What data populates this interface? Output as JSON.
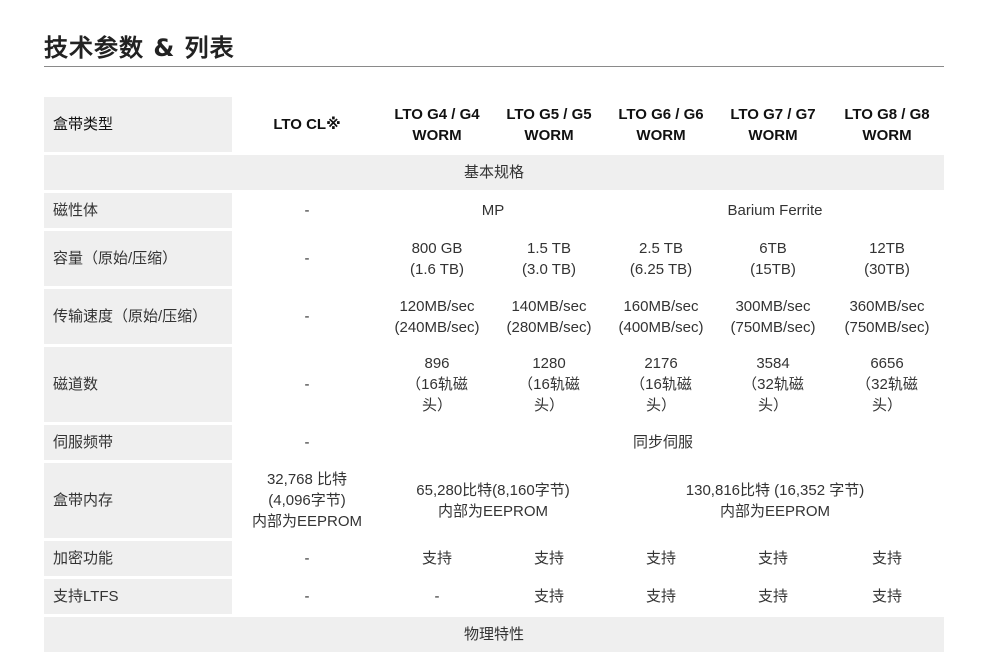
{
  "title": "技术参数 & 列表",
  "header": {
    "label": "盒带类型",
    "cols": [
      "LTO CL※",
      "LTO G4 / G4 WORM",
      "LTO G5 / G5 WORM",
      "LTO G6 / G6 WORM",
      "LTO G7 / G7 WORM",
      "LTO G8 / G8 WORM"
    ]
  },
  "sections": {
    "basic": "基本规格",
    "physical": "物理特性"
  },
  "rows": {
    "magnetic": {
      "label": "磁性体",
      "cl": "-",
      "mp": "MP",
      "baf": "Barium Ferrite"
    },
    "capacity": {
      "label": "容量（原始/压缩）",
      "cells": [
        "-",
        "800 GB\n(1.6 TB)",
        "1.5 TB\n(3.0 TB)",
        "2.5 TB\n(6.25 TB)",
        "6TB\n(15TB)",
        "12TB\n(30TB)"
      ]
    },
    "speed": {
      "label": "传输速度（原始/压缩）",
      "cells": [
        "-",
        "120MB/sec\n(240MB/sec)",
        "140MB/sec\n(280MB/sec)",
        "160MB/sec\n(400MB/sec)",
        "300MB/sec\n(750MB/sec)",
        "360MB/sec\n(750MB/sec)"
      ]
    },
    "tracks": {
      "label": "磁道数",
      "cells": [
        "-",
        "896\n（16轨磁\n头）",
        "1280\n（16轨磁\n头）",
        "2176\n（16轨磁\n头）",
        "3584\n（32轨磁\n头）",
        "6656\n（32轨磁\n头）"
      ]
    },
    "servo": {
      "label": "伺服频带",
      "cl": "-",
      "rest": "同步伺服"
    },
    "memory": {
      "label": "盒带内存",
      "cl": "32,768 比特\n(4,096字节)\n内部为EEPROM",
      "g45": "65,280比特(8,160字节)\n内部为EEPROM",
      "g678": "130,816比特 (16,352 字节)\n内部为EEPROM"
    },
    "encryption": {
      "label": "加密功能",
      "cells": [
        "-",
        "支持",
        "支持",
        "支持",
        "支持",
        "支持"
      ]
    },
    "ltfs": {
      "label": "支持LTFS",
      "cells": [
        "-",
        "-",
        "支持",
        "支持",
        "支持",
        "支持"
      ]
    }
  }
}
